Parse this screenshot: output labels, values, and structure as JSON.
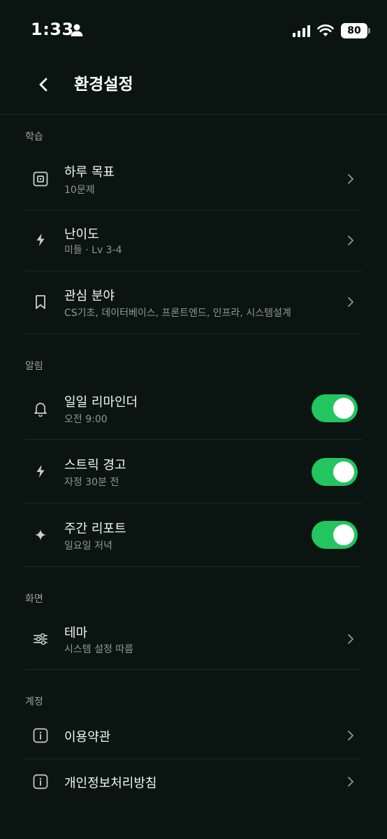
{
  "status_bar": {
    "time": "1:33",
    "battery": "80"
  },
  "header": {
    "title": "환경설정"
  },
  "sections": [
    {
      "label": "학습",
      "items": [
        {
          "title": "하루 목표",
          "subtitle": "10문제",
          "icon": "target-icon"
        },
        {
          "title": "난이도",
          "subtitle": "미들 · Lv 3-4",
          "icon": "bolt-icon"
        },
        {
          "title": "관심 분야",
          "subtitle": "CS기초, 데이터베이스, 프론트엔드, 인프라, 시스템설계",
          "icon": "bookmark-icon"
        }
      ]
    },
    {
      "label": "알림",
      "items": [
        {
          "title": "일일 리마인더",
          "subtitle": "오전 9:00",
          "icon": "bell-icon",
          "toggle": true
        },
        {
          "title": "스트릭 경고",
          "subtitle": "자정 30분 전",
          "icon": "bolt-icon",
          "toggle": true
        },
        {
          "title": "주간 리포트",
          "subtitle": "일요일 저녁",
          "icon": "sparkle-icon",
          "toggle": true
        }
      ]
    },
    {
      "label": "화면",
      "items": [
        {
          "title": "테마",
          "subtitle": "시스템 설정 따름",
          "icon": "sliders-icon"
        }
      ]
    },
    {
      "label": "계정",
      "items": [
        {
          "title": "이용약관",
          "icon": "info-icon"
        },
        {
          "title": "개인정보처리방침",
          "icon": "info-icon"
        }
      ]
    }
  ],
  "colors": {
    "background": "#0a1410",
    "toggle_on": "#22c55e",
    "divider": "#1f2b25"
  }
}
